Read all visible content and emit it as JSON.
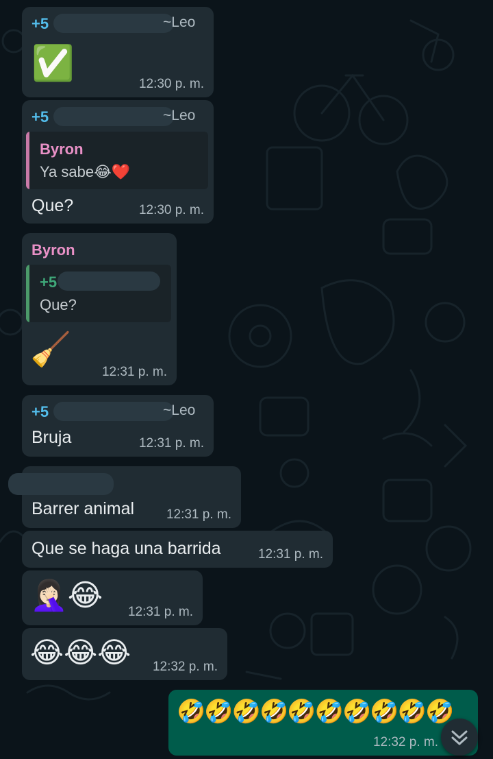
{
  "colors": {
    "background": "#0b141a",
    "incoming_bubble": "#202c33",
    "outgoing_bubble": "#005c4b",
    "sender_leo_prefix": "#53bdeb",
    "sender_byron": "#e991c7",
    "quote_bar_byron": "#c97aa8",
    "quote_bar_leo": "#4c9a6a",
    "timestamp": "#aebac1"
  },
  "messages": [
    {
      "sender_prefix": "+5",
      "pushname": "~Leo",
      "emoji": "✅",
      "time": "12:30 p. m."
    },
    {
      "sender_prefix": "+5",
      "pushname": "~Leo",
      "quote": {
        "author": "Byron",
        "text": "Ya sabe",
        "emoji": "😂❤️"
      },
      "text": "Que?",
      "time": "12:30 p. m."
    },
    {
      "sender": "Byron",
      "quote": {
        "author_prefix": "+5",
        "text": "Que?"
      },
      "emoji": "🧹",
      "time": "12:31 p. m."
    },
    {
      "sender_prefix": "+5",
      "pushname": "~Leo",
      "text": "Bruja",
      "time": "12:31 p. m."
    },
    {
      "text": "Barrer animal",
      "time": "12:31 p. m."
    },
    {
      "text": "Que se haga una barrida",
      "time": "12:31 p. m."
    },
    {
      "emoji": "🤦🏻‍♀️😂",
      "time": "12:31 p. m."
    },
    {
      "emoji": "😂😂😂",
      "time": "12:32 p. m."
    },
    {
      "emoji": "🤣🤣🤣🤣🤣🤣🤣🤣🤣🤣",
      "time": "12:32 p. m."
    }
  ],
  "scroll_button": {
    "icon": "double-chevron-down-icon"
  }
}
